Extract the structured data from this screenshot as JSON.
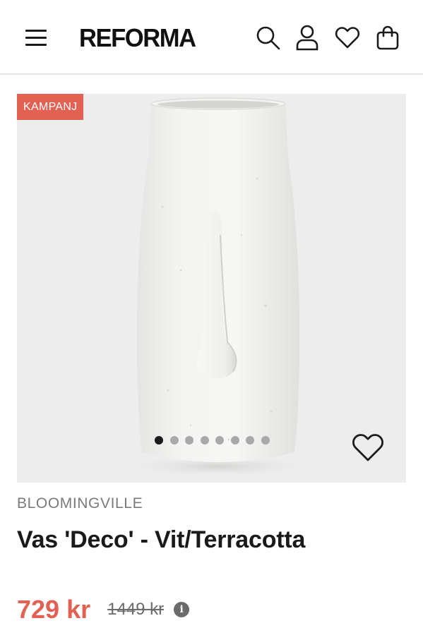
{
  "header": {
    "logo": "REFORMA",
    "icons": [
      "menu-icon",
      "search-icon",
      "user-icon",
      "heart-icon",
      "shopping-bag-icon"
    ]
  },
  "product": {
    "badge": "KAMPANJ",
    "brand": "BLOOMINGVILLE",
    "title": "Vas 'Deco' - Vit/Terracotta",
    "price": "729 kr",
    "original_price": "1449 kr",
    "info_icon": "i",
    "image": {
      "subject": "white textured vase with face relief",
      "slide_count": 8,
      "active_slide": 1
    }
  },
  "colors": {
    "accent": "#e26152",
    "text": "#1a1a1a",
    "muted": "#7a7a7a",
    "image_bg": "#ededed"
  }
}
